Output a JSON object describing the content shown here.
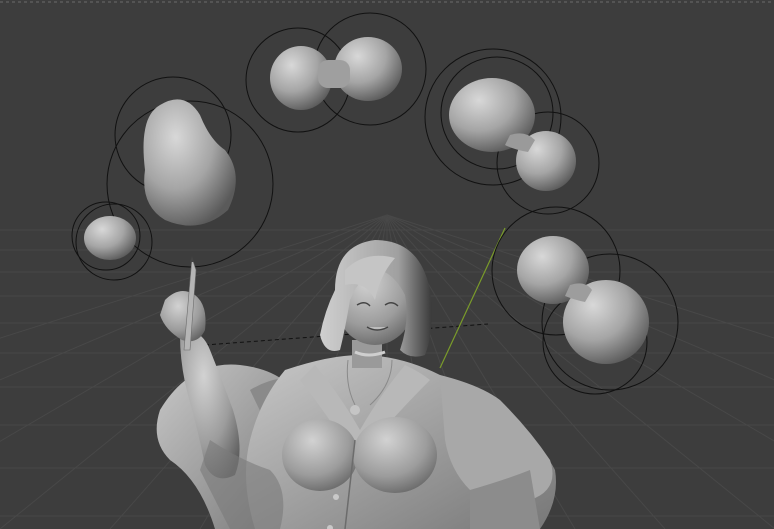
{
  "viewport": {
    "mode": "sculpt-viewport",
    "background_color": "#3d3d3d",
    "grid_color": "#4a4a4a",
    "horizon_dashed_line": true,
    "axis_line_color": "#7a9b2a",
    "icons": [
      "metaball-icon",
      "influence-circle-icon",
      "sculpt-figure-icon"
    ]
  },
  "objects": {
    "metaball_groups": [
      "metaball-group-top",
      "metaball-group-top-right",
      "metaball-group-left",
      "metaball-group-left-small",
      "metaball-group-right"
    ],
    "figure": "sculpted-character",
    "pencil": "held-pencil"
  }
}
